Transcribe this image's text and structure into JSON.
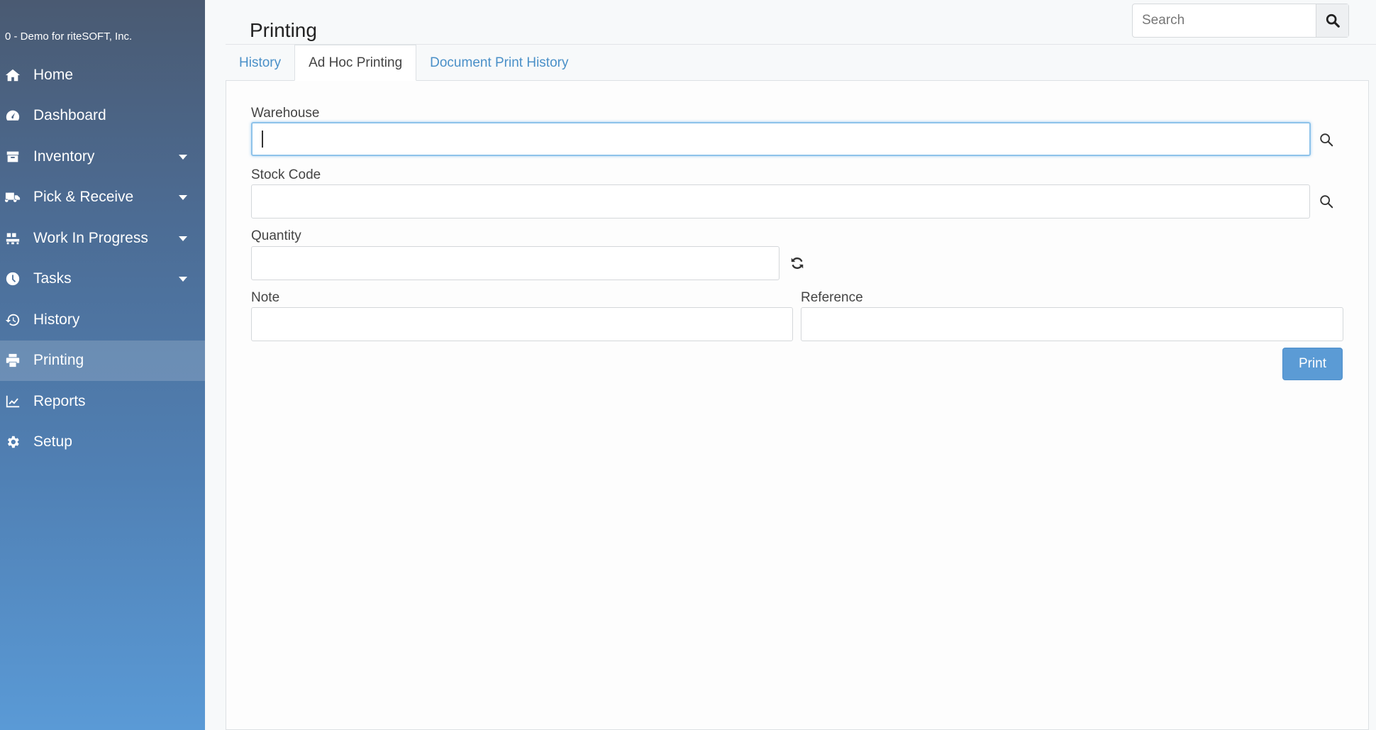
{
  "company": "0 - Demo for riteSOFT, Inc.",
  "sidebar": {
    "items": [
      {
        "label": "Home",
        "icon": "home-icon",
        "caret": false,
        "active": false
      },
      {
        "label": "Dashboard",
        "icon": "dashboard-icon",
        "caret": false,
        "active": false
      },
      {
        "label": "Inventory",
        "icon": "box-icon",
        "caret": true,
        "active": false
      },
      {
        "label": "Pick & Receive",
        "icon": "truck-icon",
        "caret": true,
        "active": false
      },
      {
        "label": "Work In Progress",
        "icon": "conveyor-icon",
        "caret": true,
        "active": false
      },
      {
        "label": "Tasks",
        "icon": "clock-icon",
        "caret": true,
        "active": false
      },
      {
        "label": "History",
        "icon": "history-icon",
        "caret": false,
        "active": false
      },
      {
        "label": "Printing",
        "icon": "printer-icon",
        "caret": false,
        "active": true
      },
      {
        "label": "Reports",
        "icon": "line-chart-icon",
        "caret": false,
        "active": false
      },
      {
        "label": "Setup",
        "icon": "gear-icon",
        "caret": false,
        "active": false
      }
    ]
  },
  "header": {
    "title": "Printing",
    "search_placeholder": "Search"
  },
  "tabs": [
    {
      "label": "History",
      "active": false
    },
    {
      "label": "Ad Hoc Printing",
      "active": true
    },
    {
      "label": "Document Print History",
      "active": false
    }
  ],
  "form": {
    "warehouse": {
      "label": "Warehouse",
      "value": ""
    },
    "stock_code": {
      "label": "Stock Code",
      "value": ""
    },
    "quantity": {
      "label": "Quantity",
      "value": ""
    },
    "note": {
      "label": "Note",
      "value": ""
    },
    "reference": {
      "label": "Reference",
      "value": ""
    },
    "print_label": "Print"
  },
  "colors": {
    "accent": "#5b9bd5",
    "tab_link": "#4a90c8",
    "sidebar_top": "#4a5a72",
    "sidebar_bottom": "#5a9ad6"
  }
}
